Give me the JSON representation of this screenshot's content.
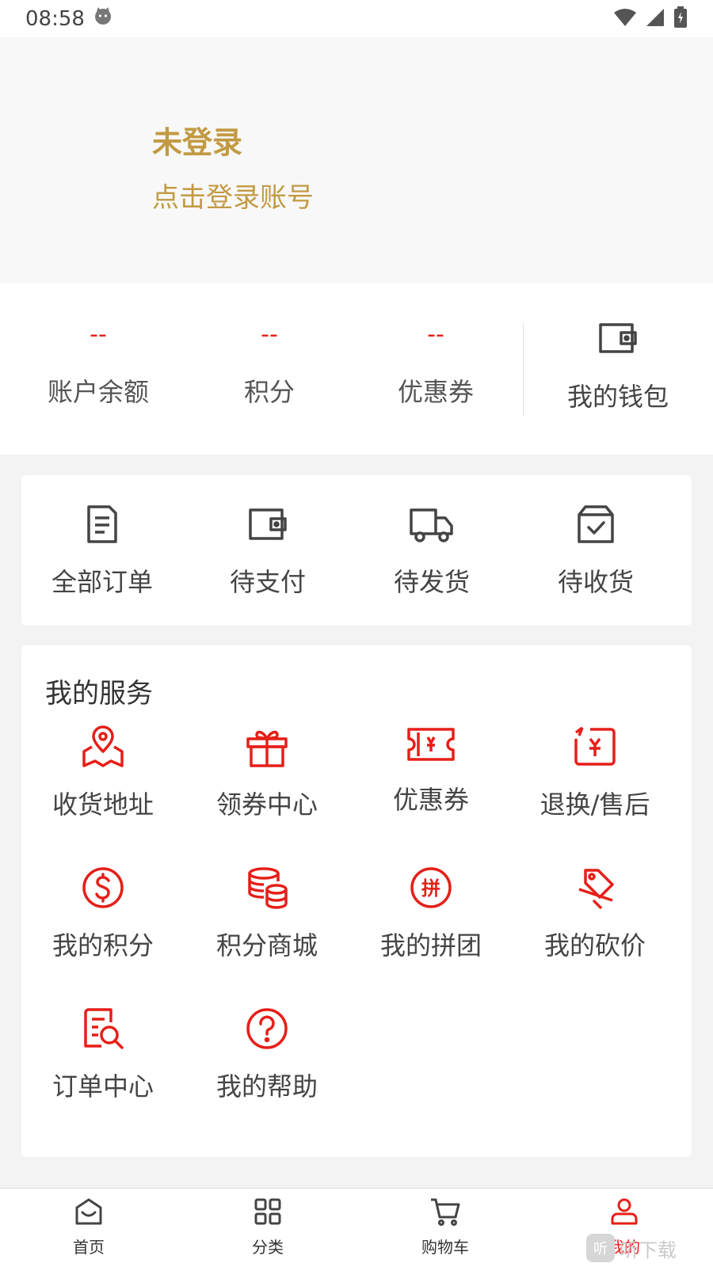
{
  "status_bar": {
    "time": "08:58"
  },
  "header": {
    "title": "未登录",
    "subtitle": "点击登录账号"
  },
  "stats": {
    "items": [
      {
        "value": "--",
        "label": "账户余额"
      },
      {
        "value": "--",
        "label": "积分"
      },
      {
        "value": "--",
        "label": "优惠券"
      }
    ],
    "wallet_label": "我的钱包"
  },
  "orders": {
    "items": [
      {
        "label": "全部订单",
        "icon": "document-icon"
      },
      {
        "label": "待支付",
        "icon": "wallet-icon"
      },
      {
        "label": "待发货",
        "icon": "truck-icon"
      },
      {
        "label": "待收货",
        "icon": "box-check-icon"
      }
    ]
  },
  "services": {
    "title": "我的服务",
    "items": [
      {
        "label": "收货地址",
        "icon": "location-map-icon"
      },
      {
        "label": "领券中心",
        "icon": "gift-icon"
      },
      {
        "label": "优惠券",
        "icon": "ticket-icon"
      },
      {
        "label": "退换/售后",
        "icon": "refund-icon"
      },
      {
        "label": "我的积分",
        "icon": "coin-dollar-icon"
      },
      {
        "label": "积分商城",
        "icon": "coins-stack-icon"
      },
      {
        "label": "我的拼团",
        "icon": "group-buy-icon"
      },
      {
        "label": "我的砍价",
        "icon": "price-tag-icon"
      },
      {
        "label": "订单中心",
        "icon": "order-search-icon"
      },
      {
        "label": "我的帮助",
        "icon": "help-icon"
      }
    ],
    "icon_color": "#e61f19"
  },
  "bottom_nav": {
    "items": [
      {
        "label": "首页",
        "icon": "home-icon"
      },
      {
        "label": "分类",
        "icon": "grid-icon"
      },
      {
        "label": "购物车",
        "icon": "cart-icon"
      },
      {
        "label": "我的",
        "icon": "user-icon"
      }
    ],
    "active": "我的"
  },
  "watermark": {
    "text": "听下载"
  },
  "colors": {
    "accent_red": "#e61f19",
    "gold": "#c29a43"
  }
}
